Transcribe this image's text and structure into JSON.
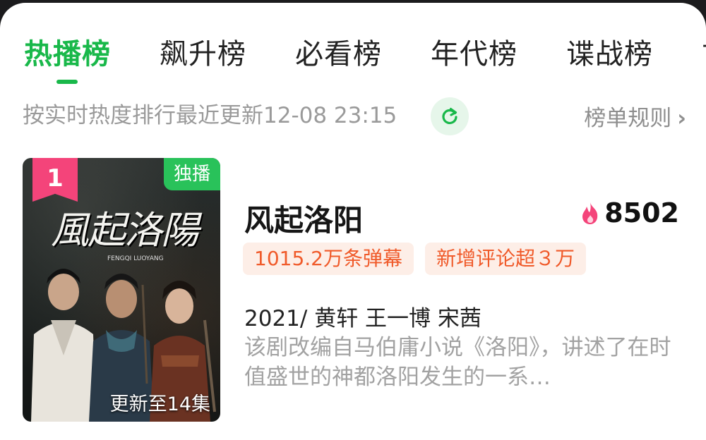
{
  "tabs": [
    {
      "label": "热播榜",
      "active": true
    },
    {
      "label": "飙升榜",
      "active": false
    },
    {
      "label": "必看榜",
      "active": false
    },
    {
      "label": "年代榜",
      "active": false
    },
    {
      "label": "谍战榜",
      "active": false
    },
    {
      "label": "古",
      "active": false
    }
  ],
  "subbar": {
    "update_text": "按实时热度排行最近更新12-08 23:15",
    "rules_label": "榜单规则"
  },
  "item": {
    "rank": "1",
    "exclusive_label": "独播",
    "poster_title": "風起洛陽",
    "poster_subtitle": "FENGQI LUOYANG",
    "episode_label": "更新至14集",
    "title": "风起洛阳",
    "heat": "8502",
    "tags": [
      "1015.2万条弹幕",
      "新增评论超３万"
    ],
    "meta": "2021/ 黄轩 王一博 宋茜",
    "description": "该剧改编自马伯庸小说《洛阳》，讲述了在时值盛世的神都洛阳发生的一系…"
  },
  "colors": {
    "accent": "#19b84a",
    "rank_badge": "#f4447a",
    "tag_text": "#f05a2a",
    "tag_bg": "#fdeee7",
    "heat_icon": "#f4447a"
  }
}
